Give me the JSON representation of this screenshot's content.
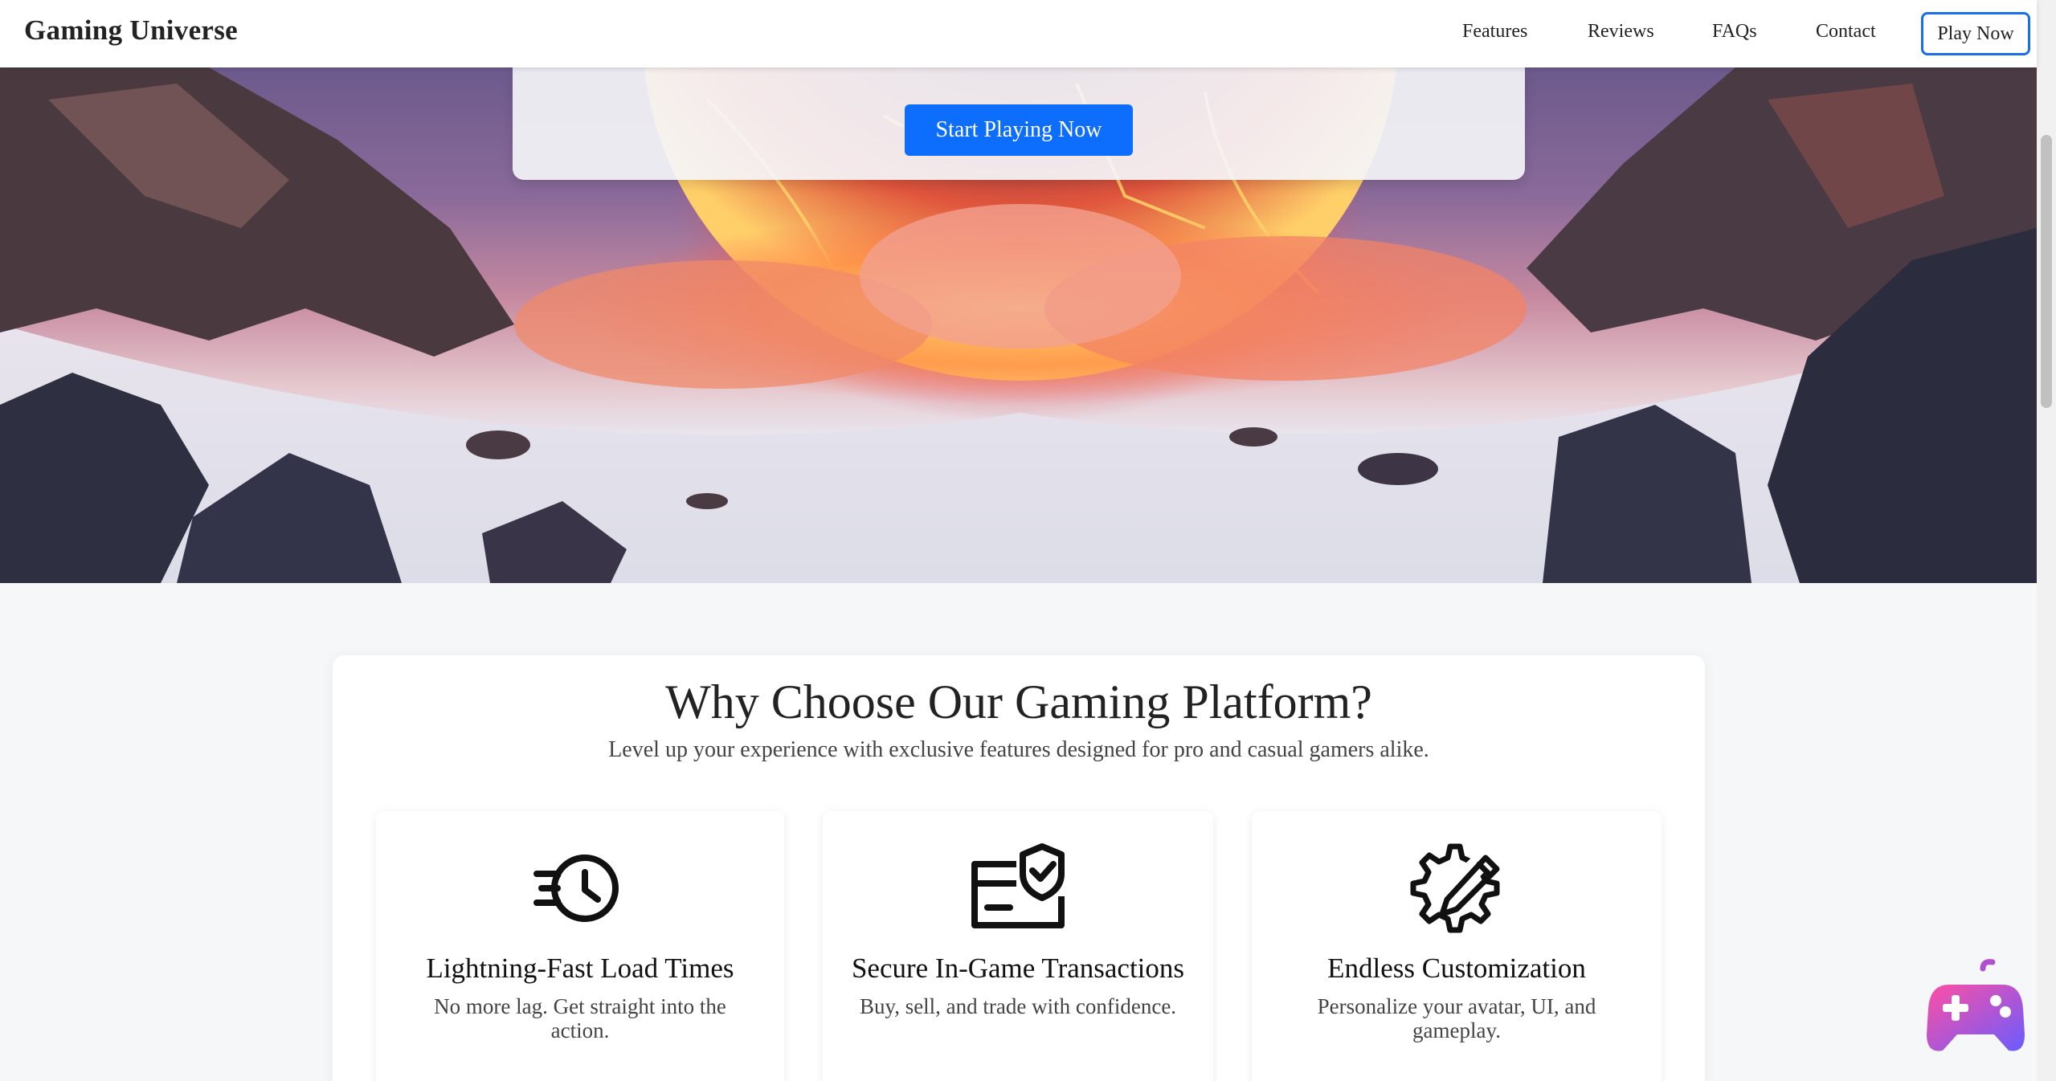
{
  "brand": {
    "name": "Gaming Universe"
  },
  "nav": {
    "links": [
      "Features",
      "Reviews",
      "FAQs",
      "Contact"
    ],
    "cta": "Play Now"
  },
  "hero": {
    "cta": "Start Playing Now"
  },
  "features": {
    "title": "Why Choose Our Gaming Platform?",
    "subtitle": "Level up your experience with exclusive features designed for pro and casual gamers alike.",
    "cards": [
      {
        "icon": "fast-clock-icon",
        "title": "Lightning-Fast Load Times",
        "desc": "No more lag. Get straight into the action."
      },
      {
        "icon": "secure-card-icon",
        "title": "Secure In-Game Transactions",
        "desc": "Buy, sell, and trade with confidence."
      },
      {
        "icon": "gear-pencil-icon",
        "title": "Endless Customization",
        "desc": "Personalize your avatar, UI, and gameplay."
      }
    ]
  },
  "floating_button": {
    "icon": "gamepad-icon"
  },
  "colors": {
    "accent": "#0d6efd",
    "cta_border": "#1a6ee6",
    "fab_gradient_start": "#ff4fa3",
    "fab_gradient_end": "#6a5cff"
  }
}
